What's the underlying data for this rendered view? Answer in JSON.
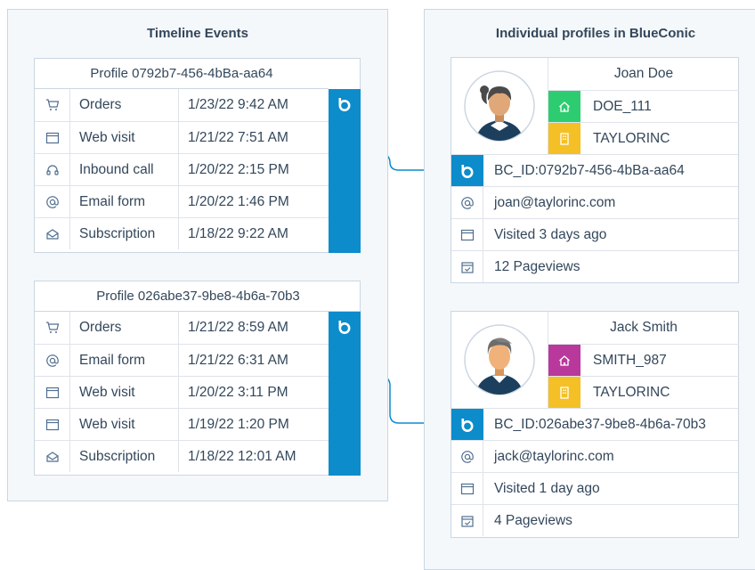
{
  "colors": {
    "accent": "#0c8ccb",
    "green": "#2ecc71",
    "yellow": "#f5c026",
    "magenta": "#b8399b",
    "line": "#0c8ccb"
  },
  "left_panel": {
    "title": "Timeline Events",
    "profiles": [
      {
        "header": "Profile 0792b7-456-4bBa-aa64",
        "events": [
          {
            "icon": "cart-icon",
            "label": "Orders",
            "time": "1/23/22 9:42 AM"
          },
          {
            "icon": "browser-icon",
            "label": "Web visit",
            "time": "1/21/22 7:51 AM"
          },
          {
            "icon": "headset-icon",
            "label": "Inbound call",
            "time": "1/20/22 2:15 PM"
          },
          {
            "icon": "at-icon",
            "label": "Email form",
            "time": "1/20/22 1:46 PM"
          },
          {
            "icon": "envelope-icon",
            "label": "Subscription",
            "time": "1/18/22 9:22 AM"
          }
        ]
      },
      {
        "header": "Profile 026abe37-9be8-4b6a-70b3",
        "events": [
          {
            "icon": "cart-icon",
            "label": "Orders",
            "time": "1/21/22 8:59 AM"
          },
          {
            "icon": "at-icon",
            "label": "Email form",
            "time": "1/21/22 6:31 AM"
          },
          {
            "icon": "browser-icon",
            "label": "Web visit",
            "time": "1/20/22 3:11 PM"
          },
          {
            "icon": "browser-icon",
            "label": "Web visit",
            "time": "1/19/22 1:20 PM"
          },
          {
            "icon": "envelope-icon",
            "label": "Subscription",
            "time": "1/18/22 12:01 AM"
          }
        ]
      }
    ]
  },
  "right_panel": {
    "title": "Individual profiles in BlueConic",
    "profiles": [
      {
        "name": "Joan Doe",
        "attrs": [
          {
            "icon": "home-icon",
            "color": "green",
            "text": "DOE_111"
          },
          {
            "icon": "building-icon",
            "color": "yellow",
            "text": "TAYLORINC"
          }
        ],
        "bc_id": "BC_ID:0792b7-456-4bBa-aa64",
        "rows": [
          {
            "icon": "at-icon",
            "text": "joan@taylorinc.com"
          },
          {
            "icon": "browser-icon",
            "text": "Visited 3 days ago"
          },
          {
            "icon": "calendar-check-icon",
            "text": "12 Pageviews"
          }
        ]
      },
      {
        "name": "Jack Smith",
        "attrs": [
          {
            "icon": "home-icon",
            "color": "magenta",
            "text": "SMITH_987"
          },
          {
            "icon": "building-icon",
            "color": "yellow",
            "text": "TAYLORINC"
          }
        ],
        "bc_id": "BC_ID:026abe37-9be8-4b6a-70b3",
        "rows": [
          {
            "icon": "at-icon",
            "text": "jack@taylorinc.com"
          },
          {
            "icon": "browser-icon",
            "text": "Visited 1 day ago"
          },
          {
            "icon": "calendar-check-icon",
            "text": "4 Pageviews"
          }
        ]
      }
    ]
  }
}
